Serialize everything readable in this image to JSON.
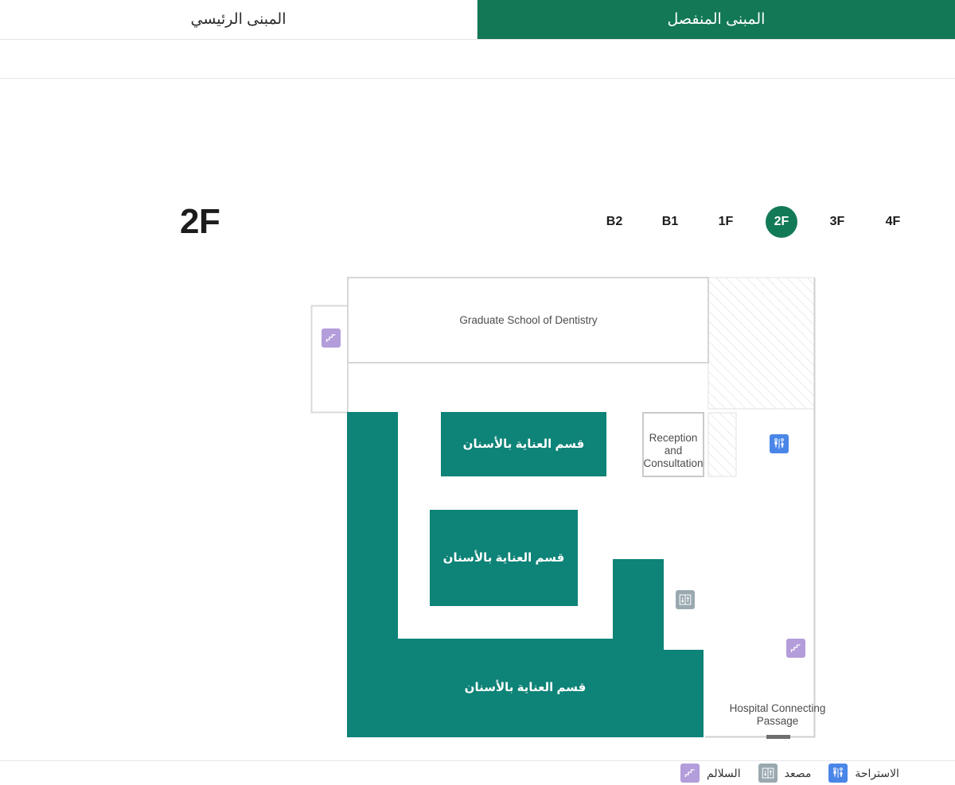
{
  "header": {
    "tabs": [
      {
        "label": "المبنى المنفصل",
        "active": true,
        "name": "tab-separate-building"
      },
      {
        "label": "المبنى الرئيسي",
        "active": false,
        "name": "tab-main-building"
      }
    ]
  },
  "floor_view": {
    "current_floor_heading": "2F",
    "floors": [
      {
        "label": "B2",
        "active": false
      },
      {
        "label": "B1",
        "active": false
      },
      {
        "label": "1F",
        "active": false
      },
      {
        "label": "2F",
        "active": true
      },
      {
        "label": "3F",
        "active": false
      },
      {
        "label": "4F",
        "active": false
      }
    ]
  },
  "map": {
    "rooms": [
      {
        "id": "graduate-school",
        "label": "Graduate School of Dentistry",
        "lang": "en"
      },
      {
        "id": "dental-care-1",
        "label": "قسم العناية بالأسنان",
        "lang": "ar"
      },
      {
        "id": "dental-care-2",
        "label": "قسم العناية بالأسنان",
        "lang": "ar"
      },
      {
        "id": "dental-care-3",
        "label": "قسم العناية بالأسنان",
        "lang": "ar"
      },
      {
        "id": "reception",
        "label": "Reception and Consultation",
        "lang": "en"
      },
      {
        "id": "connecting-passage",
        "label": "Hospital Connecting Passage",
        "lang": "en"
      }
    ],
    "facility_markers": [
      {
        "id": "stairs-top-left",
        "type": "stairs"
      },
      {
        "id": "restroom-right",
        "type": "restroom"
      },
      {
        "id": "elevator-center",
        "type": "elevator"
      },
      {
        "id": "stairs-bottom-right",
        "type": "stairs"
      }
    ]
  },
  "legend": {
    "items": [
      {
        "type": "stairs",
        "label": "السلالم"
      },
      {
        "type": "elevator",
        "label": "مصعد"
      },
      {
        "type": "restroom",
        "label": "الاستراحة"
      }
    ]
  },
  "colors": {
    "header_active": "#127855",
    "floor_active": "#137a57",
    "room_teal": "#0e8377",
    "stairs": "#b39ddb",
    "elevator": "#9aa9b0",
    "restroom": "#4a86e8",
    "outline": "#cfcfcf"
  }
}
